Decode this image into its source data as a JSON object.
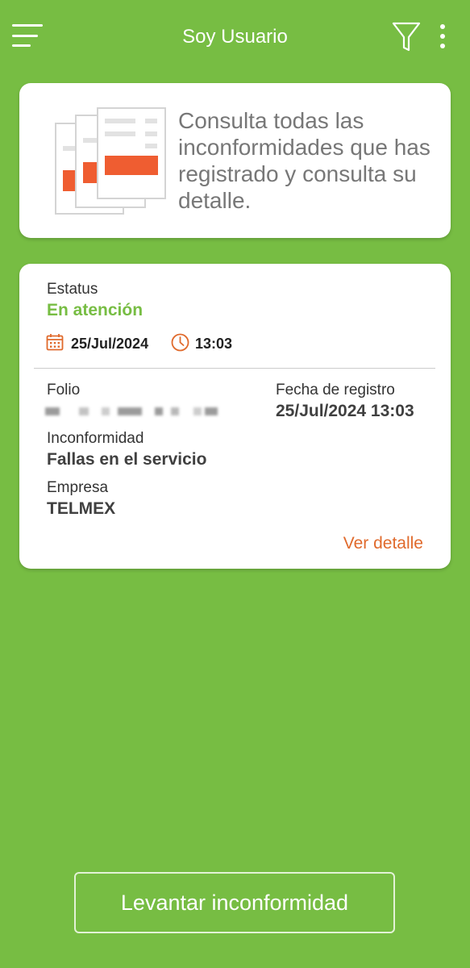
{
  "appbar": {
    "title": "Soy Usuario",
    "menu_icon": "hamburger-menu-icon",
    "filter_icon": "filter-icon",
    "more_icon": "more-vert-icon",
    "icon_color": "#ffffff"
  },
  "intro": {
    "text": "Consulta todas las inconformidades que has registrado y consulta su detalle.",
    "illustration": "documents-icon",
    "accent_color": "#ef5d31"
  },
  "complaint": {
    "status_label": "Estatus",
    "status_value": "En atención",
    "status_color": "#77bd43",
    "date": "25/Jul/2024",
    "time": "13:03",
    "date_icon": "calendar-icon",
    "time_icon": "clock-icon",
    "folio_label": "Folio",
    "registration_label": "Fecha de registro",
    "registration_value": "25/Jul/2024 13:03",
    "complaint_label": "Inconformidad",
    "complaint_value": "Fallas en el servicio",
    "company_label": "Empresa",
    "company_value": "TELMEX",
    "detail_link": "Ver detalle",
    "link_color": "#e06a2c"
  },
  "actions": {
    "primary_button": "Levantar inconformidad"
  },
  "theme": {
    "background": "#77bd43",
    "card": "#ffffff"
  }
}
